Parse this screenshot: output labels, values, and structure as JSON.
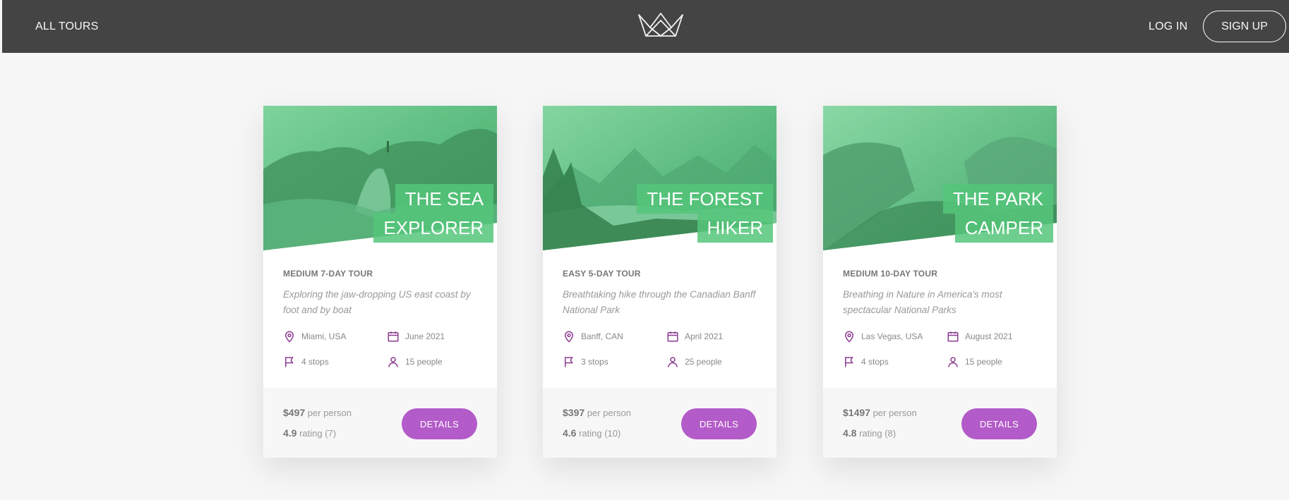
{
  "header": {
    "all_tours": "All tours",
    "log_in": "Log in",
    "sign_up": "Sign up",
    "logo_icon": "crown-logo-icon"
  },
  "colors": {
    "header_bg": "#444444",
    "page_bg": "#f6f6f6",
    "accent_green": "#55c57a",
    "button_purple": "#b35bc9",
    "icon_purple": "#8a3b8f"
  },
  "tours": [
    {
      "title_line1": "The Sea",
      "title_line2": "Explorer",
      "difficulty": "Medium 7-day tour",
      "summary": "Exploring the jaw-dropping US east coast by foot and by boat",
      "location": "Miami, USA",
      "date": "June 2021",
      "stops": "4 stops",
      "people": "15 people",
      "price": "$497",
      "price_label": "per person",
      "rating": "4.9",
      "rating_label": "rating (7)",
      "button": "Details"
    },
    {
      "title_line1": "The Forest",
      "title_line2": "Hiker",
      "difficulty": "Easy 5-day tour",
      "summary": "Breathtaking hike through the Canadian Banff National Park",
      "location": "Banff, CAN",
      "date": "April 2021",
      "stops": "3 stops",
      "people": "25 people",
      "price": "$397",
      "price_label": "per person",
      "rating": "4.6",
      "rating_label": "rating (10)",
      "button": "Details"
    },
    {
      "title_line1": "The Park",
      "title_line2": "Camper",
      "difficulty": "Medium 10-day tour",
      "summary": "Breathing in Nature in America's most spectacular National Parks",
      "location": "Las Vegas, USA",
      "date": "August 2021",
      "stops": "4 stops",
      "people": "15 people",
      "price": "$1497",
      "price_label": "per person",
      "rating": "4.8",
      "rating_label": "rating (8)",
      "button": "Details"
    }
  ]
}
